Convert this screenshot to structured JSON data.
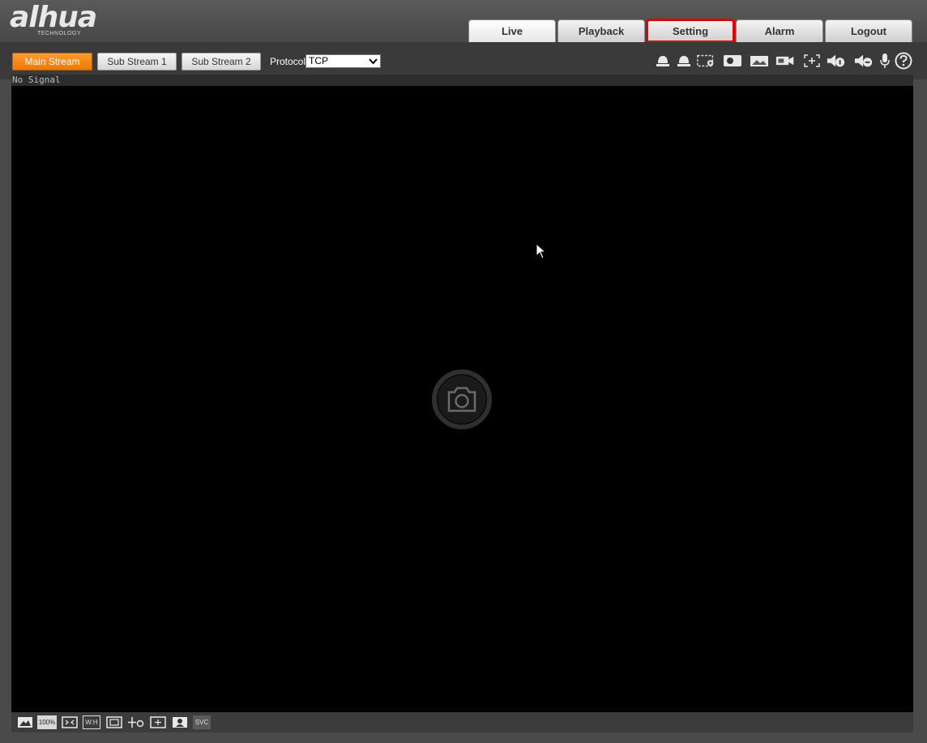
{
  "brand": {
    "logo_text": "alhua",
    "logo_sub": "TECHNOLOGY"
  },
  "nav": {
    "live": "Live",
    "playback": "Playback",
    "setting": "Setting",
    "alarm": "Alarm",
    "logout": "Logout",
    "active_tab": "Setting",
    "highlight_color": "#e00000"
  },
  "streams": {
    "main": "Main Stream",
    "sub1": "Sub Stream 1",
    "sub2": "Sub Stream 2",
    "selected": "Main Stream",
    "accent_color": "#f07800"
  },
  "protocol": {
    "label": "Protocol",
    "value": "TCP"
  },
  "toolbar_icons": [
    "lock-icon",
    "alarm-light-icon",
    "region-zoom-icon",
    "record-icon",
    "snapshot-icon",
    "video-record-icon",
    "digital-zoom-icon",
    "audio-output-icon",
    "talk-icon",
    "microphone-icon",
    "help-icon"
  ],
  "video": {
    "status": "No Signal"
  },
  "bottom_controls": {
    "percent": "100%",
    "wh": "W:H",
    "svc": "SVC"
  }
}
